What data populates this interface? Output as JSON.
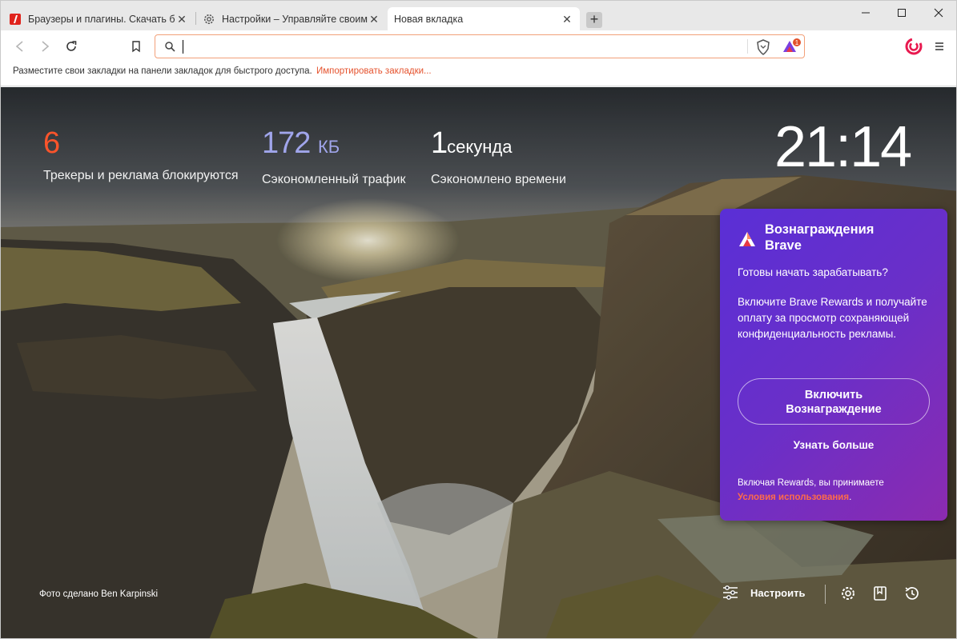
{
  "tabs": [
    {
      "title": "Браузеры и плагины. Скачать бе",
      "icon": "site-favicon-red",
      "active": false
    },
    {
      "title": "Настройки – Управляйте своими",
      "icon": "settings-gear-icon",
      "active": false
    },
    {
      "title": "Новая вкладка",
      "icon": "",
      "active": true
    }
  ],
  "new_tab_symbol": "+",
  "address": {
    "value": "",
    "placeholder": ""
  },
  "bookmarks_bar": {
    "hint": "Разместите свои закладки на панели закладок для быстрого доступа.",
    "import_link": "Импортировать закладки..."
  },
  "badge_count": "1",
  "stats": {
    "trackers": {
      "value": "6",
      "label": "Трекеры и реклама блокируются",
      "color": "#fb542b"
    },
    "bandwidth": {
      "value": "172",
      "unit": "КБ",
      "label": "Сэкономленный трафик",
      "color": "#a0a5eb"
    },
    "time": {
      "value": "1",
      "unit": "секунда",
      "label": "Сэкономлено времени",
      "color": "#ffffff"
    }
  },
  "clock": "21:14",
  "rewards": {
    "title_line1": "Вознаграждения",
    "title_line2": "Brave",
    "question": "Готовы начать зарабатывать?",
    "description": "Включите Brave Rewards и получайте оплату за просмотр сохраняющей конфиденциальность рекламы.",
    "enable_line1": "Включить",
    "enable_line2": "Вознаграждение",
    "learn_more": "Узнать больше",
    "terms_prefix": "Включая Rewards, вы принимаете",
    "terms_link": "Условия использования",
    "terms_suffix": "."
  },
  "photo_credit": "Фото сделано Ben Karpinski",
  "customize_label": "Настроить",
  "colors": {
    "accent": "#fb542b",
    "rewards_bg": "#6a2fc8"
  }
}
